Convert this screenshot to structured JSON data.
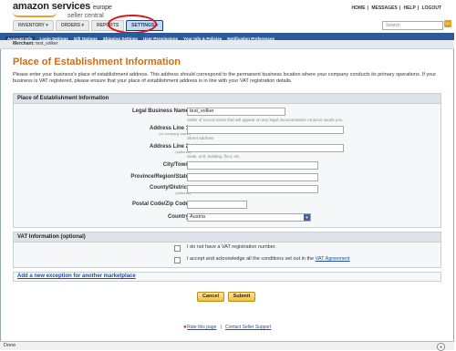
{
  "header": {
    "brand": "amazon services",
    "brand_region": "europe",
    "brand_sub": "seller central",
    "top_links": [
      "HOME",
      "MESSAGES",
      "HELP",
      "LOGOUT"
    ],
    "tabs": [
      "INVENTORY ▾",
      "ORDERS ▾",
      "REPORTS",
      "SETTINGS ▾"
    ],
    "search_placeholder": "Search",
    "go_label": "GO"
  },
  "subnav": {
    "items": [
      "Account Info",
      "Login Settings",
      "Gift Options",
      "Shipping Settings",
      "User Permissions",
      "Your Info & Policies",
      "Notification Preferences"
    ]
  },
  "merchant": {
    "label": "Merchant:",
    "value": "test_volker"
  },
  "page": {
    "title": "Place of Establishment Information",
    "intro": "Please enter your business's place of establishment address. This address should correspond to the permanent business location where your company conducts its primary operations. If your business is VAT registered, please ensure that your place of establishment address is in line with your VAT registration details."
  },
  "establishment_panel": {
    "heading": "Place of Establishment Information",
    "legal_name_label": "Legal Business Name:",
    "legal_name_value": "test_volker",
    "legal_name_hint": "Seller of record name that will appear on any legal documentation Amazon sends you.",
    "address1_label": "Address Line 1:",
    "address1_sub": "(or company name)",
    "address1_hint": "Street address",
    "address2_label": "Address Line 2:",
    "address2_sub": "(optional)",
    "address2_hint": "Suite, unit, building, floor, etc.",
    "city_label": "City/Town:",
    "province_label": "Province/Region/State:",
    "county_label": "County/District:",
    "county_sub": "(optional)",
    "postal_label": "Postal Code/Zip Code:",
    "country_label": "Country:",
    "country_value": "Austria"
  },
  "vat_panel": {
    "heading": "VAT Information (optional)",
    "no_vat_text": "I do not have a VAT registration number.",
    "accept_text": "I accept and acknowledge all the conditions set out in the",
    "accept_link": "VAT Agreement"
  },
  "exception_link": "Add a new exception for another marketplace",
  "buttons": {
    "cancel": "Cancel",
    "submit": "Submit"
  },
  "footer": {
    "rate": "Rate this page",
    "separator": "|",
    "contact": "Contact Seller Support"
  },
  "statusbar": {
    "status": "Done"
  }
}
